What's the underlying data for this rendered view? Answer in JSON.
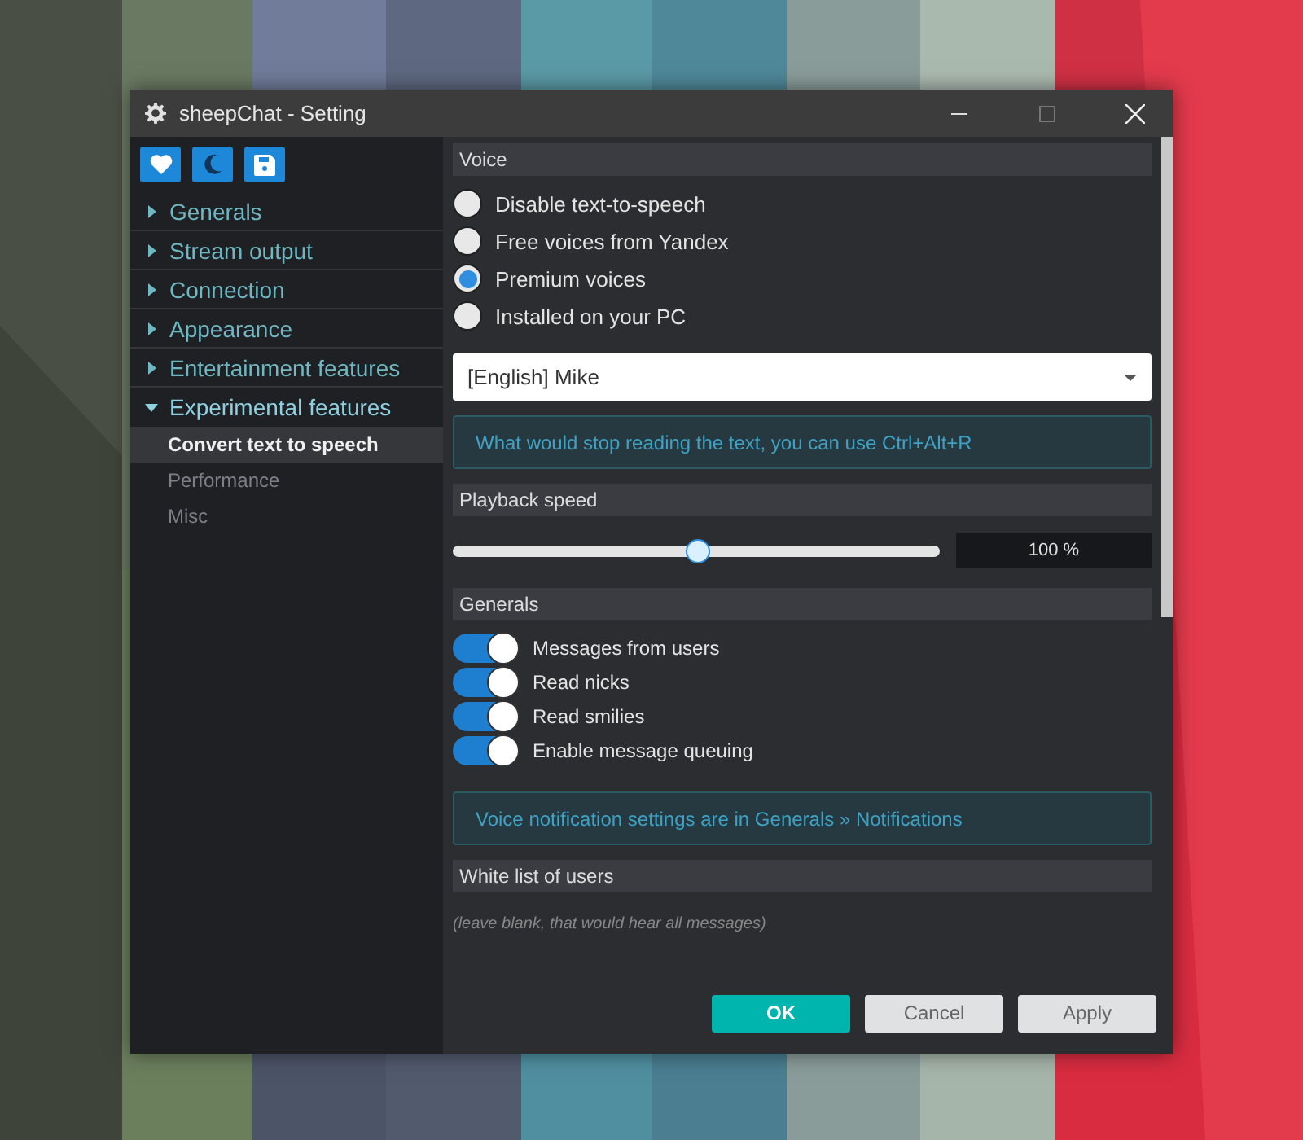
{
  "window": {
    "title": "sheepChat - Setting"
  },
  "sidebar": {
    "items": [
      {
        "label": "Generals",
        "expanded": false
      },
      {
        "label": "Stream output",
        "expanded": false
      },
      {
        "label": "Connection",
        "expanded": false
      },
      {
        "label": "Appearance",
        "expanded": false
      },
      {
        "label": "Entertainment features",
        "expanded": false
      },
      {
        "label": "Experimental features",
        "expanded": true,
        "children": [
          {
            "label": "Convert text to speech",
            "selected": true
          },
          {
            "label": "Performance",
            "selected": false
          },
          {
            "label": "Misc",
            "selected": false
          }
        ]
      }
    ]
  },
  "voice": {
    "heading": "Voice",
    "options": [
      {
        "label": "Disable text-to-speech",
        "selected": false
      },
      {
        "label": "Free voices from Yandex",
        "selected": false
      },
      {
        "label": "Premium voices",
        "selected": true
      },
      {
        "label": "Installed on your PC",
        "selected": false
      }
    ],
    "select": {
      "value": "[English] Mike"
    },
    "info": "What would stop reading the text, you can use Ctrl+Alt+R"
  },
  "playback": {
    "heading": "Playback speed",
    "slider": {
      "level": 0.5
    },
    "reading": "100 %"
  },
  "generals": {
    "heading": "Generals",
    "toggles": [
      {
        "label": "Messages from users",
        "on": true
      },
      {
        "label": "Read nicks",
        "on": true
      },
      {
        "label": "Read smilies",
        "on": true
      },
      {
        "label": "Enable message queuing",
        "on": true
      }
    ],
    "info": "Voice notification settings are in Generals » Notifications"
  },
  "whitelist": {
    "heading": "White list of users",
    "placeholder": "(leave blank, that would hear all messages)"
  },
  "buttons": [
    {
      "label": "OK",
      "kind": "primary"
    },
    {
      "label": "Cancel",
      "kind": "secondary"
    },
    {
      "label": "Apply",
      "kind": "secondary"
    }
  ]
}
